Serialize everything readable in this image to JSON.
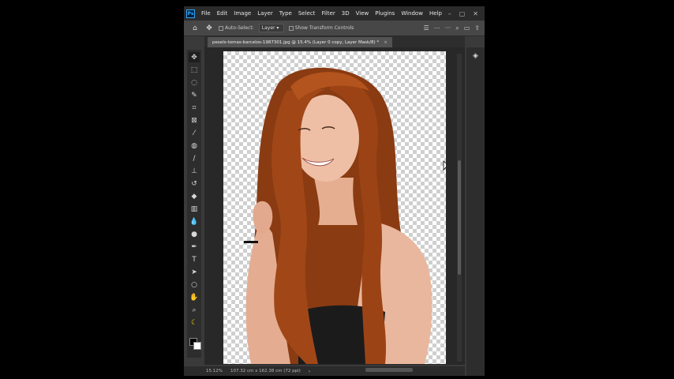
{
  "app": {
    "logo": "Ps",
    "menu": [
      "File",
      "Edit",
      "Image",
      "Layer",
      "Type",
      "Select",
      "Filter",
      "3D",
      "View",
      "Plugins",
      "Window",
      "Help"
    ],
    "window_controls": [
      "–",
      "▢",
      "✕"
    ]
  },
  "options_bar": {
    "home_icon": "home-icon",
    "move_icon": "move-tool-icon",
    "auto_select_label": "Auto-Select:",
    "auto_select_value": "Layer",
    "transform_label": "Show Transform Controls"
  },
  "document": {
    "tab_title": "pexels-tomas-barcelos-1987301.jpg @ 15.4% (Layer 0 copy, Layer Mask/8) *",
    "close_glyph": "×"
  },
  "toolbar": {
    "tools": [
      "move-tool",
      "marquee-tool",
      "lasso-tool",
      "quick-select-tool",
      "crop-tool",
      "frame-tool",
      "eyedropper-tool",
      "healing-brush-tool",
      "brush-tool",
      "clone-stamp-tool",
      "history-brush-tool",
      "eraser-tool",
      "gradient-tool",
      "blur-tool",
      "dodge-tool",
      "pen-tool",
      "type-tool",
      "path-select-tool",
      "shape-tool",
      "hand-tool",
      "zoom-tool",
      "edit-toolbar"
    ]
  },
  "status": {
    "zoom": "15.12%",
    "dimensions": "107.32 cm x 162.38 cm (72 ppi)",
    "arrow": "›"
  },
  "colors": {
    "foreground": "#000000",
    "background": "#ffffff",
    "accent": "#31a8ff"
  }
}
